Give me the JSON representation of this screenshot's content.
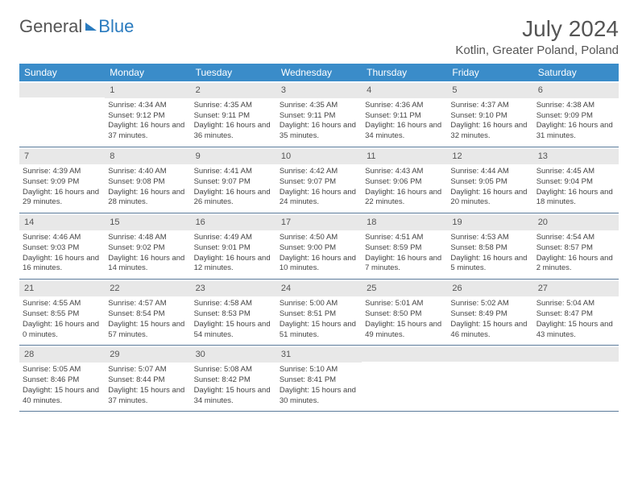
{
  "logo": {
    "part1": "General",
    "part2": "Blue"
  },
  "title": "July 2024",
  "location": "Kotlin, Greater Poland, Poland",
  "weekdays": [
    "Sunday",
    "Monday",
    "Tuesday",
    "Wednesday",
    "Thursday",
    "Friday",
    "Saturday"
  ],
  "weeks": [
    [
      {
        "day": "",
        "sunrise": "",
        "sunset": "",
        "daylight": ""
      },
      {
        "day": "1",
        "sunrise": "Sunrise: 4:34 AM",
        "sunset": "Sunset: 9:12 PM",
        "daylight": "Daylight: 16 hours and 37 minutes."
      },
      {
        "day": "2",
        "sunrise": "Sunrise: 4:35 AM",
        "sunset": "Sunset: 9:11 PM",
        "daylight": "Daylight: 16 hours and 36 minutes."
      },
      {
        "day": "3",
        "sunrise": "Sunrise: 4:35 AM",
        "sunset": "Sunset: 9:11 PM",
        "daylight": "Daylight: 16 hours and 35 minutes."
      },
      {
        "day": "4",
        "sunrise": "Sunrise: 4:36 AM",
        "sunset": "Sunset: 9:11 PM",
        "daylight": "Daylight: 16 hours and 34 minutes."
      },
      {
        "day": "5",
        "sunrise": "Sunrise: 4:37 AM",
        "sunset": "Sunset: 9:10 PM",
        "daylight": "Daylight: 16 hours and 32 minutes."
      },
      {
        "day": "6",
        "sunrise": "Sunrise: 4:38 AM",
        "sunset": "Sunset: 9:09 PM",
        "daylight": "Daylight: 16 hours and 31 minutes."
      }
    ],
    [
      {
        "day": "7",
        "sunrise": "Sunrise: 4:39 AM",
        "sunset": "Sunset: 9:09 PM",
        "daylight": "Daylight: 16 hours and 29 minutes."
      },
      {
        "day": "8",
        "sunrise": "Sunrise: 4:40 AM",
        "sunset": "Sunset: 9:08 PM",
        "daylight": "Daylight: 16 hours and 28 minutes."
      },
      {
        "day": "9",
        "sunrise": "Sunrise: 4:41 AM",
        "sunset": "Sunset: 9:07 PM",
        "daylight": "Daylight: 16 hours and 26 minutes."
      },
      {
        "day": "10",
        "sunrise": "Sunrise: 4:42 AM",
        "sunset": "Sunset: 9:07 PM",
        "daylight": "Daylight: 16 hours and 24 minutes."
      },
      {
        "day": "11",
        "sunrise": "Sunrise: 4:43 AM",
        "sunset": "Sunset: 9:06 PM",
        "daylight": "Daylight: 16 hours and 22 minutes."
      },
      {
        "day": "12",
        "sunrise": "Sunrise: 4:44 AM",
        "sunset": "Sunset: 9:05 PM",
        "daylight": "Daylight: 16 hours and 20 minutes."
      },
      {
        "day": "13",
        "sunrise": "Sunrise: 4:45 AM",
        "sunset": "Sunset: 9:04 PM",
        "daylight": "Daylight: 16 hours and 18 minutes."
      }
    ],
    [
      {
        "day": "14",
        "sunrise": "Sunrise: 4:46 AM",
        "sunset": "Sunset: 9:03 PM",
        "daylight": "Daylight: 16 hours and 16 minutes."
      },
      {
        "day": "15",
        "sunrise": "Sunrise: 4:48 AM",
        "sunset": "Sunset: 9:02 PM",
        "daylight": "Daylight: 16 hours and 14 minutes."
      },
      {
        "day": "16",
        "sunrise": "Sunrise: 4:49 AM",
        "sunset": "Sunset: 9:01 PM",
        "daylight": "Daylight: 16 hours and 12 minutes."
      },
      {
        "day": "17",
        "sunrise": "Sunrise: 4:50 AM",
        "sunset": "Sunset: 9:00 PM",
        "daylight": "Daylight: 16 hours and 10 minutes."
      },
      {
        "day": "18",
        "sunrise": "Sunrise: 4:51 AM",
        "sunset": "Sunset: 8:59 PM",
        "daylight": "Daylight: 16 hours and 7 minutes."
      },
      {
        "day": "19",
        "sunrise": "Sunrise: 4:53 AM",
        "sunset": "Sunset: 8:58 PM",
        "daylight": "Daylight: 16 hours and 5 minutes."
      },
      {
        "day": "20",
        "sunrise": "Sunrise: 4:54 AM",
        "sunset": "Sunset: 8:57 PM",
        "daylight": "Daylight: 16 hours and 2 minutes."
      }
    ],
    [
      {
        "day": "21",
        "sunrise": "Sunrise: 4:55 AM",
        "sunset": "Sunset: 8:55 PM",
        "daylight": "Daylight: 16 hours and 0 minutes."
      },
      {
        "day": "22",
        "sunrise": "Sunrise: 4:57 AM",
        "sunset": "Sunset: 8:54 PM",
        "daylight": "Daylight: 15 hours and 57 minutes."
      },
      {
        "day": "23",
        "sunrise": "Sunrise: 4:58 AM",
        "sunset": "Sunset: 8:53 PM",
        "daylight": "Daylight: 15 hours and 54 minutes."
      },
      {
        "day": "24",
        "sunrise": "Sunrise: 5:00 AM",
        "sunset": "Sunset: 8:51 PM",
        "daylight": "Daylight: 15 hours and 51 minutes."
      },
      {
        "day": "25",
        "sunrise": "Sunrise: 5:01 AM",
        "sunset": "Sunset: 8:50 PM",
        "daylight": "Daylight: 15 hours and 49 minutes."
      },
      {
        "day": "26",
        "sunrise": "Sunrise: 5:02 AM",
        "sunset": "Sunset: 8:49 PM",
        "daylight": "Daylight: 15 hours and 46 minutes."
      },
      {
        "day": "27",
        "sunrise": "Sunrise: 5:04 AM",
        "sunset": "Sunset: 8:47 PM",
        "daylight": "Daylight: 15 hours and 43 minutes."
      }
    ],
    [
      {
        "day": "28",
        "sunrise": "Sunrise: 5:05 AM",
        "sunset": "Sunset: 8:46 PM",
        "daylight": "Daylight: 15 hours and 40 minutes."
      },
      {
        "day": "29",
        "sunrise": "Sunrise: 5:07 AM",
        "sunset": "Sunset: 8:44 PM",
        "daylight": "Daylight: 15 hours and 37 minutes."
      },
      {
        "day": "30",
        "sunrise": "Sunrise: 5:08 AM",
        "sunset": "Sunset: 8:42 PM",
        "daylight": "Daylight: 15 hours and 34 minutes."
      },
      {
        "day": "31",
        "sunrise": "Sunrise: 5:10 AM",
        "sunset": "Sunset: 8:41 PM",
        "daylight": "Daylight: 15 hours and 30 minutes."
      },
      {
        "day": "",
        "sunrise": "",
        "sunset": "",
        "daylight": ""
      },
      {
        "day": "",
        "sunrise": "",
        "sunset": "",
        "daylight": ""
      },
      {
        "day": "",
        "sunrise": "",
        "sunset": "",
        "daylight": ""
      }
    ]
  ]
}
